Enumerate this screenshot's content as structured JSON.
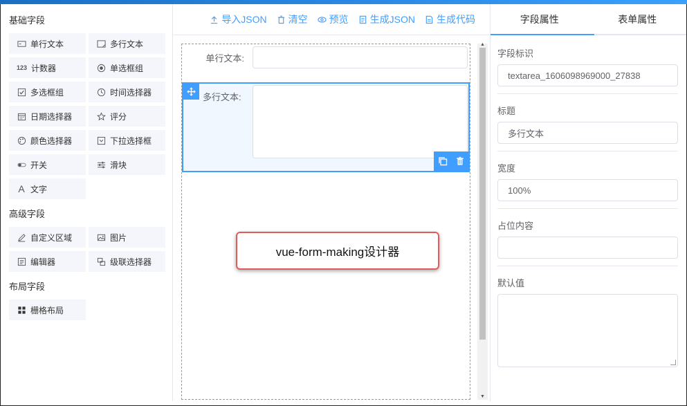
{
  "left": {
    "basic_title": "基础字段",
    "basic_items": [
      {
        "label": "单行文本",
        "icon": "input-icon"
      },
      {
        "label": "多行文本",
        "icon": "textarea-icon"
      },
      {
        "label": "计数器",
        "icon": "number-icon"
      },
      {
        "label": "单选框组",
        "icon": "radio-icon"
      },
      {
        "label": "多选框组",
        "icon": "checkbox-icon"
      },
      {
        "label": "时间选择器",
        "icon": "clock-icon"
      },
      {
        "label": "日期选择器",
        "icon": "calendar-icon"
      },
      {
        "label": "评分",
        "icon": "star-icon"
      },
      {
        "label": "颜色选择器",
        "icon": "palette-icon"
      },
      {
        "label": "下拉选择框",
        "icon": "select-icon"
      },
      {
        "label": "开关",
        "icon": "switch-icon"
      },
      {
        "label": "滑块",
        "icon": "slider-icon"
      },
      {
        "label": "文字",
        "icon": "text-icon"
      }
    ],
    "advanced_title": "高级字段",
    "advanced_items": [
      {
        "label": "自定义区域",
        "icon": "pen-icon"
      },
      {
        "label": "图片",
        "icon": "image-icon"
      },
      {
        "label": "编辑器",
        "icon": "editor-icon"
      },
      {
        "label": "级联选择器",
        "icon": "cascader-icon"
      }
    ],
    "layout_title": "布局字段",
    "layout_items": [
      {
        "label": "栅格布局",
        "icon": "grid-icon"
      }
    ]
  },
  "toolbar": {
    "import": "导入JSON",
    "clear": "清空",
    "preview": "预览",
    "gen_json": "生成JSON",
    "gen_code": "生成代码"
  },
  "canvas": {
    "field1_label": "单行文本:",
    "field2_label": "多行文本:",
    "banner": "vue-form-making设计器"
  },
  "right": {
    "tabs": [
      "字段属性",
      "表单属性"
    ],
    "props": {
      "id_label": "字段标识",
      "id_value": "textarea_1606098969000_27838",
      "title_label": "标题",
      "title_value": "多行文本",
      "width_label": "宽度",
      "width_value": "100%",
      "placeholder_label": "占位内容",
      "placeholder_value": "",
      "default_label": "默认值"
    }
  },
  "colors": {
    "accent": "#409eff",
    "banner_border": "#e25a5a"
  }
}
